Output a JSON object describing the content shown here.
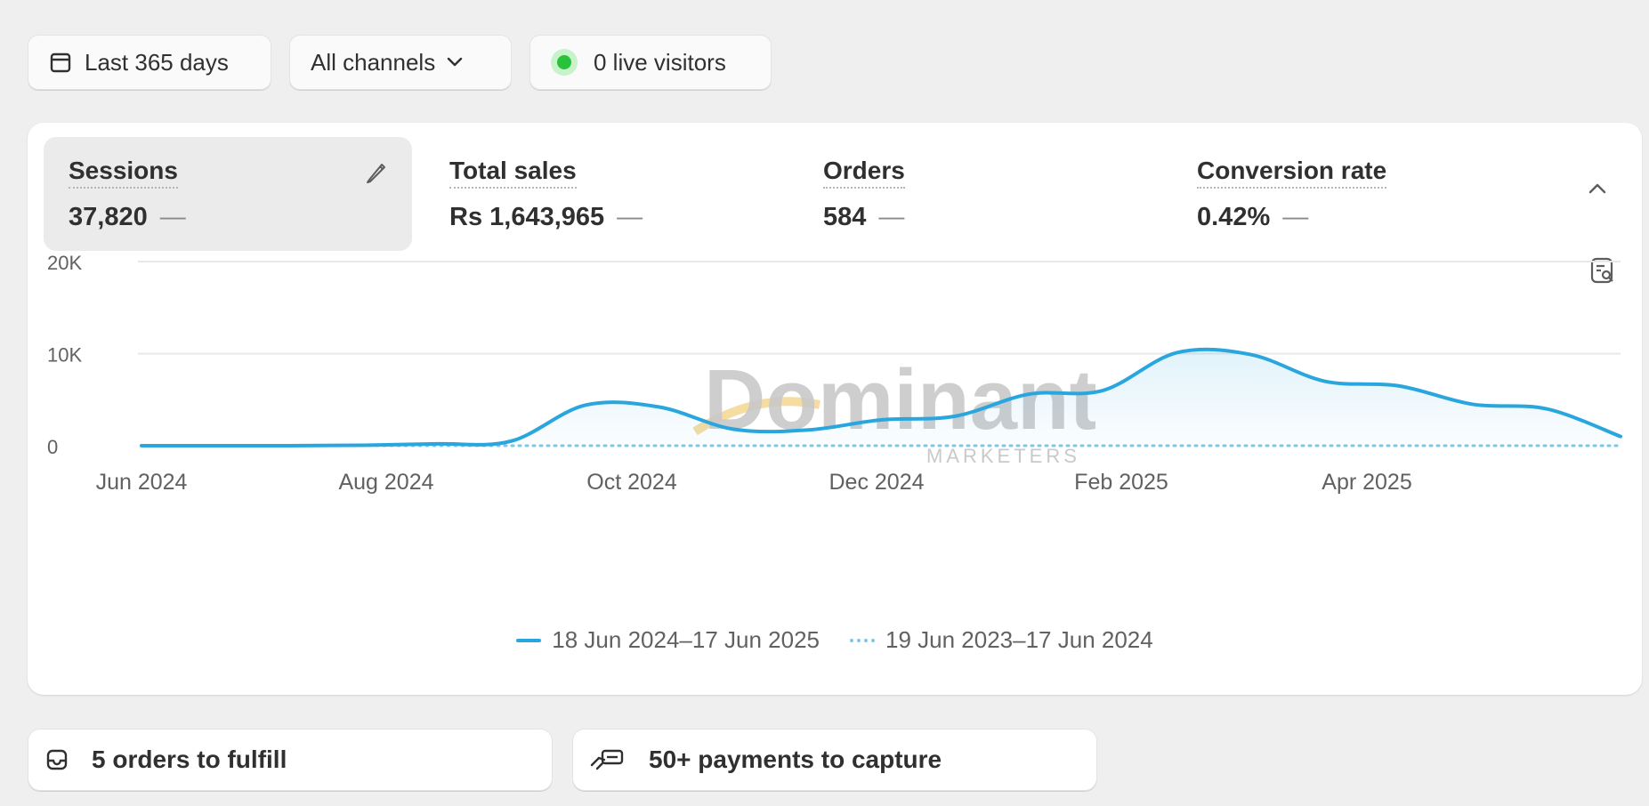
{
  "filters": {
    "date_range": "Last 365 days",
    "channels": "All channels",
    "live_visitors": "0 live visitors"
  },
  "metrics": [
    {
      "label": "Sessions",
      "value": "37,820",
      "trend": "—",
      "active": true
    },
    {
      "label": "Total sales",
      "value": "Rs 1,643,965",
      "trend": "—"
    },
    {
      "label": "Orders",
      "value": "584",
      "trend": "—"
    },
    {
      "label": "Conversion rate",
      "value": "0.42%",
      "trend": "—"
    }
  ],
  "watermark": {
    "brand": "Dominant",
    "sub": "MARKETERS"
  },
  "chart_data": {
    "type": "line",
    "metric": "Sessions",
    "y_ticks": [
      "20K",
      "10K",
      "0"
    ],
    "ylim": [
      0,
      20000
    ],
    "x_tick_labels": [
      "Jun 2024",
      "Aug 2024",
      "Oct 2024",
      "Dec 2024",
      "Feb 2025",
      "Apr 2025"
    ],
    "x": [
      "Jun 2024",
      "Jul 2024",
      "Aug 2024",
      "Sep 2024",
      "Oct 2024",
      "Oct 2024 (late)",
      "Nov 2024",
      "Nov 2024 (late)",
      "Dec 2024",
      "Dec 2024 (late)",
      "Jan 2025",
      "Jan 2025 (late)",
      "Feb 2025",
      "Feb 2025 (late)",
      "Mar 2025",
      "Mar 2025 (late)",
      "Apr 2025",
      "Apr 2025 (late)",
      "May 2025",
      "May 2025 (late)",
      "Jun 2025"
    ],
    "series": [
      {
        "name": "18 Jun 2024–17 Jun 2025",
        "style": "solid",
        "color": "#2aa6df",
        "values": [
          0,
          0,
          0,
          50,
          200,
          500,
          4400,
          4200,
          1800,
          1700,
          2800,
          3200,
          5600,
          6000,
          10100,
          9900,
          7000,
          6500,
          4500,
          4000,
          1000
        ]
      },
      {
        "name": "19 Jun 2023–17 Jun 2024",
        "style": "dotted",
        "color": "#7cc7ea",
        "values": [
          0,
          0,
          0,
          0,
          0,
          0,
          0,
          0,
          0,
          0,
          0,
          0,
          0,
          0,
          0,
          0,
          0,
          0,
          0,
          0,
          0
        ]
      }
    ],
    "grid": true,
    "legend_position": "bottom"
  },
  "tasks": [
    {
      "label": "5 orders to fulfill",
      "icon": "inbox-icon"
    },
    {
      "label": "50+ payments to capture",
      "icon": "cash-hand-icon"
    }
  ],
  "colors": {
    "accent": "#2aa6df",
    "live_dot": "#29c23a",
    "background": "#efefef"
  }
}
